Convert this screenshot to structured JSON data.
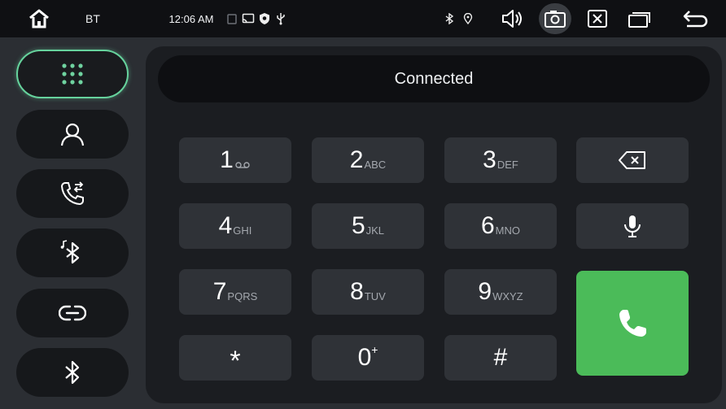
{
  "status_bar": {
    "label": "BT",
    "time": "12:06 AM"
  },
  "sidebar": {
    "items": [
      {
        "icon": "dialpad-icon",
        "active": true
      },
      {
        "icon": "contacts-icon",
        "active": false
      },
      {
        "icon": "call-log-icon",
        "active": false
      },
      {
        "icon": "bt-music-icon",
        "active": false
      },
      {
        "icon": "link-icon",
        "active": false
      },
      {
        "icon": "bluetooth-icon",
        "active": false
      }
    ]
  },
  "connection": {
    "status": "Connected"
  },
  "keypad": {
    "keys": [
      {
        "digit": "1",
        "letters": "oo"
      },
      {
        "digit": "2",
        "letters": "ABC"
      },
      {
        "digit": "3",
        "letters": "DEF"
      },
      {
        "digit": "4",
        "letters": "GHI"
      },
      {
        "digit": "5",
        "letters": "JKL"
      },
      {
        "digit": "6",
        "letters": "MNO"
      },
      {
        "digit": "7",
        "letters": "PQRS"
      },
      {
        "digit": "8",
        "letters": "TUV"
      },
      {
        "digit": "9",
        "letters": "WXYZ"
      },
      {
        "digit": "*",
        "letters": ""
      },
      {
        "digit": "0",
        "letters": "+"
      },
      {
        "digit": "#",
        "letters": ""
      }
    ]
  },
  "colors": {
    "accent_active": "#66d39d",
    "call_button": "#4bbb59",
    "panel": "#1b1d21",
    "key": "#2f3237"
  }
}
